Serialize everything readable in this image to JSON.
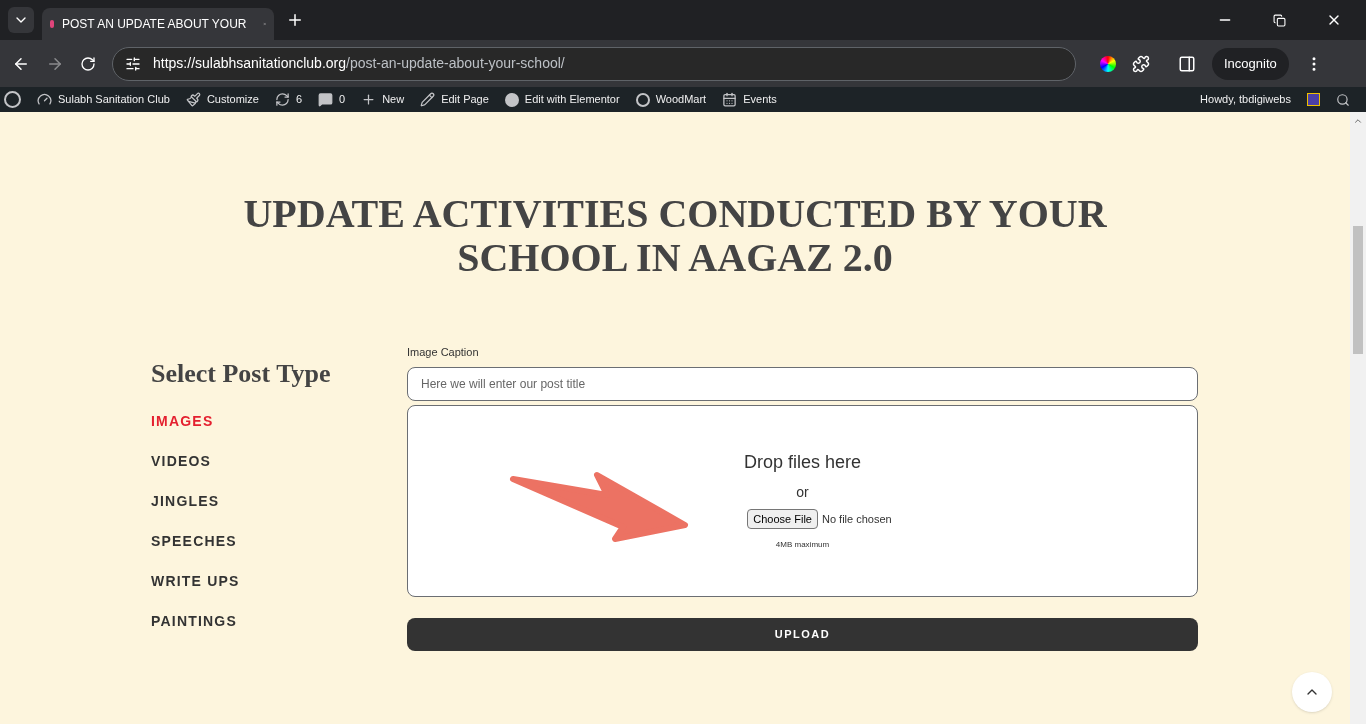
{
  "browser": {
    "tab_title": "POST AN UPDATE ABOUT YOUR",
    "url_host": "https://sulabhsanitationclub.org",
    "url_path": "/post-an-update-about-your-school/",
    "profile": "Incognito"
  },
  "admin_bar": {
    "items": [
      {
        "kind": "site",
        "label": "Sulabh Sanitation Club"
      },
      {
        "kind": "brush",
        "label": "Customize"
      },
      {
        "kind": "updates",
        "label": "6"
      },
      {
        "kind": "comments",
        "label": "0"
      },
      {
        "kind": "new",
        "label": "New"
      },
      {
        "kind": "edit",
        "label": "Edit Page"
      },
      {
        "kind": "elementor",
        "label": "Edit with Elementor"
      },
      {
        "kind": "woodmart",
        "label": "WoodMart"
      },
      {
        "kind": "events",
        "label": "Events"
      }
    ],
    "greeting": "Howdy, tbdigiwebs"
  },
  "page": {
    "heading_lines": [
      "UPDATE ACTIVITIES CONDUCTED BY YOUR",
      "SCHOOL IN AAGAZ 2.0"
    ],
    "sidebar": {
      "title": "Select Post Type",
      "items": [
        {
          "label": "IMAGES",
          "selected": true
        },
        {
          "label": "VIDEOS",
          "selected": false
        },
        {
          "label": "JINGLES",
          "selected": false
        },
        {
          "label": "SPEECHES",
          "selected": false
        },
        {
          "label": "WRITE UPS",
          "selected": false
        },
        {
          "label": "PAINTINGS",
          "selected": false
        }
      ]
    },
    "form": {
      "caption_label": "Image Caption",
      "caption_placeholder": "Here we will enter our post title",
      "drop_text": "Drop files here",
      "or_text": "or",
      "choose_file": "Choose File",
      "no_file": "No file chosen",
      "max_size": "4MB maximum",
      "upload_button": "UPLOAD"
    }
  }
}
